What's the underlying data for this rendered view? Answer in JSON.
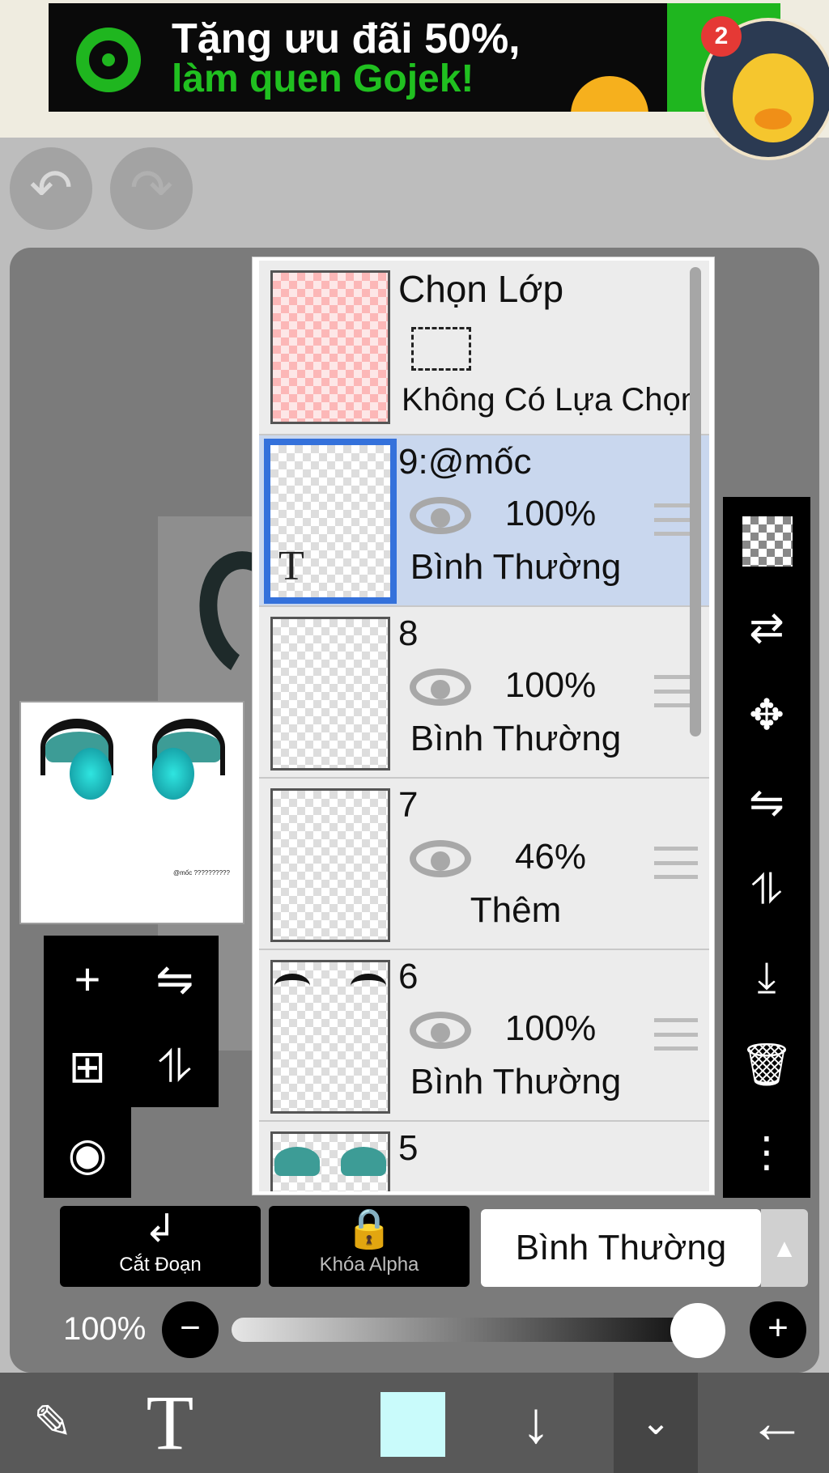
{
  "ad": {
    "line1": "Tặng ưu đãi 50%,",
    "line2": "làm quen Gojek!",
    "badge_count": "2",
    "colors": {
      "brand_green": "#1fb61f",
      "banner_bg": "#0a0a0a"
    }
  },
  "toolbar": {
    "undo_icon": "undo-icon",
    "redo_icon": "redo-icon"
  },
  "preview": {
    "watermark_text": "@mốc\n??????????"
  },
  "layers": {
    "selection_layer": {
      "title": "Chọn Lớp",
      "subtitle": "Không Có Lựa Chọn"
    },
    "items": [
      {
        "name": "9:@mốc",
        "opacity": "100%",
        "blend": "Bình Thường",
        "selected": true,
        "thumb_text": "T"
      },
      {
        "name": "8",
        "opacity": "100%",
        "blend": "Bình Thường",
        "selected": false
      },
      {
        "name": "7",
        "opacity": "46%",
        "blend": "Thêm",
        "selected": false
      },
      {
        "name": "6",
        "opacity": "100%",
        "blend": "Bình Thường",
        "selected": false
      },
      {
        "name": "5",
        "opacity": "",
        "blend": "",
        "selected": false
      }
    ]
  },
  "layer_panel": {
    "clip_label": "Cắt Đoạn",
    "alpha_lock_label": "Khóa Alpha",
    "blend_mode": "Bình Thường",
    "opacity_label": "100%",
    "opacity_value": 1.0
  },
  "bottom_bar": {
    "text_tool_glyph": "T",
    "current_color": "#c9fbfb"
  }
}
